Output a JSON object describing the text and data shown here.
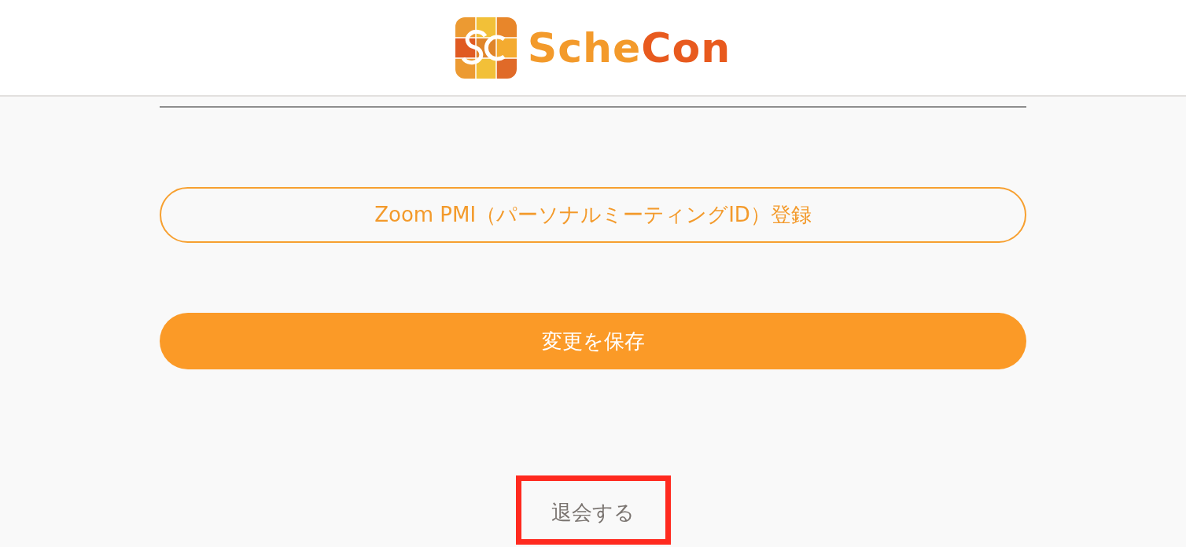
{
  "header": {
    "logo_parts": [
      {
        "text": "Sche",
        "color": "#f39a2b"
      },
      {
        "text": "Con",
        "color": "#e85a1e"
      }
    ]
  },
  "pmi_button": {
    "label": "Zoom PMI（パーソナルミーティングID）登録"
  },
  "save_button": {
    "label": "変更を保存"
  },
  "withdraw_link": {
    "label": "退会する",
    "highlighted": true
  }
}
